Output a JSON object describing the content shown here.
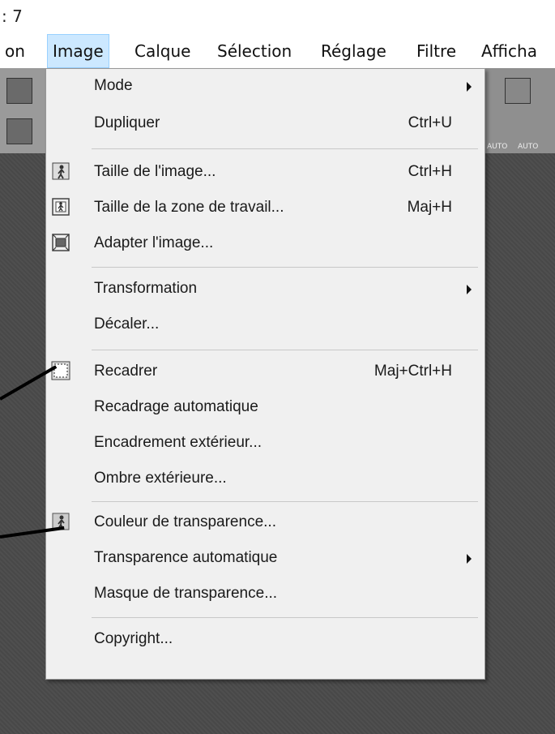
{
  "window": {
    "title": ": 7"
  },
  "menubar": {
    "items": [
      {
        "label": "on"
      },
      {
        "label": "Image"
      },
      {
        "label": "Calque"
      },
      {
        "label": "Sélection"
      },
      {
        "label": "Réglage"
      },
      {
        "label": "Filtre"
      },
      {
        "label": "Afficha"
      }
    ],
    "active_index": 1
  },
  "menu": {
    "items": [
      {
        "label": "Mode",
        "shortcut": "",
        "submenu": true,
        "icon": ""
      },
      {
        "label": "Dupliquer",
        "shortcut": "Ctrl+U",
        "submenu": false,
        "icon": ""
      },
      {
        "label": "Taille de l'image...",
        "shortcut": "Ctrl+H",
        "submenu": false,
        "icon": "image-size-icon"
      },
      {
        "label": "Taille de la zone de travail...",
        "shortcut": "Maj+H",
        "submenu": false,
        "icon": "canvas-size-icon"
      },
      {
        "label": "Adapter l'image...",
        "shortcut": "",
        "submenu": false,
        "icon": "fit-image-icon"
      },
      {
        "label": "Transformation",
        "shortcut": "",
        "submenu": true,
        "icon": ""
      },
      {
        "label": "Décaler...",
        "shortcut": "",
        "submenu": false,
        "icon": ""
      },
      {
        "label": "Recadrer",
        "shortcut": "Maj+Ctrl+H",
        "submenu": false,
        "icon": "crop-icon"
      },
      {
        "label": "Recadrage automatique",
        "shortcut": "",
        "submenu": false,
        "icon": ""
      },
      {
        "label": "Encadrement extérieur...",
        "shortcut": "",
        "submenu": false,
        "icon": ""
      },
      {
        "label": "Ombre extérieure...",
        "shortcut": "",
        "submenu": false,
        "icon": ""
      },
      {
        "label": "Couleur de transparence...",
        "shortcut": "",
        "submenu": false,
        "icon": "transparency-color-icon"
      },
      {
        "label": "Transparence automatique",
        "shortcut": "",
        "submenu": true,
        "icon": ""
      },
      {
        "label": "Masque de transparence...",
        "shortcut": "",
        "submenu": false,
        "icon": ""
      },
      {
        "label": "Copyright...",
        "shortcut": "",
        "submenu": false,
        "icon": ""
      }
    ]
  },
  "toolbar": {
    "auto_label_1": "AUTO",
    "auto_label_2": "AUTO"
  },
  "colors": {
    "menu_bg": "#f0f0f0",
    "menubar_active": "#cce8ff",
    "workspace": "#4a4a4a"
  }
}
